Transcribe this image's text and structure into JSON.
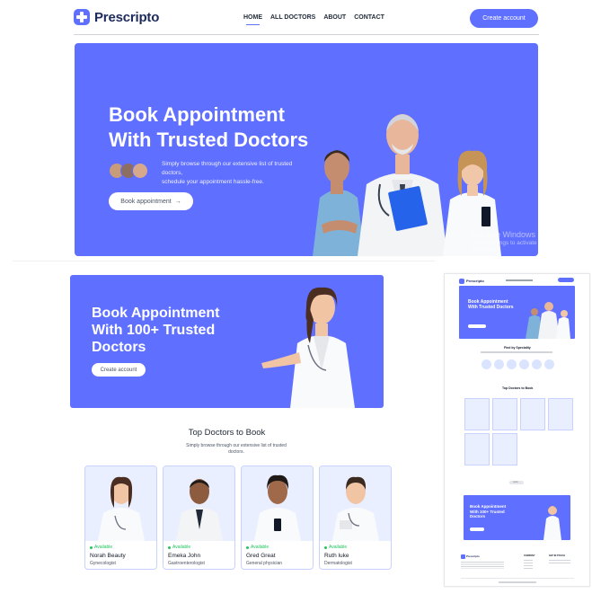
{
  "brand": {
    "name": "Prescripto"
  },
  "nav": {
    "links": [
      "HOME",
      "ALL DOCTORS",
      "ABOUT",
      "CONTACT"
    ],
    "cta": "Create account"
  },
  "hero": {
    "title_line1": "Book Appointment",
    "title_line2": "With Trusted Doctors",
    "subtitle_line1": "Simply browse through our extensive list of trusted doctors,",
    "subtitle_line2": "schedule your appointment hassle-free.",
    "button": "Book appointment",
    "arrow": "→"
  },
  "os_watermark": {
    "line1": "Activate Windows",
    "line2": "Go to Settings to activate Windows."
  },
  "banner": {
    "title_line1": "Book Appointment",
    "title_line2": "With 100+ Trusted Doctors",
    "button": "Create account"
  },
  "top_doctors": {
    "title": "Top Doctors to Book",
    "subtitle": "Simply browse through our extensive list of trusted doctors.",
    "doctors": [
      {
        "status": "Available",
        "name": "Norah Beauty",
        "specialty": "Gynecologist"
      },
      {
        "status": "Available",
        "name": "Emeka John",
        "specialty": "Gastroenterologist"
      },
      {
        "status": "Available",
        "name": "Gred Great",
        "specialty": "General physician"
      },
      {
        "status": "Available",
        "name": "Ruth luke",
        "specialty": "Dermatologist"
      }
    ]
  },
  "mini_preview": {
    "brand": "Prescripto",
    "hero_title": "Book Appointment With Trusted Doctors",
    "specialty_title": "Find by Speciality",
    "doctors_title": "Top Doctors to Book",
    "more": "more",
    "banner_title": "Book Appointment With 100+ Trusted Doctors",
    "footer_company": "COMPANY",
    "footer_contact": "GET IN TOUCH"
  },
  "colors": {
    "primary": "#5f6fff",
    "available": "#22c55e",
    "dark_text": "#1f2937"
  }
}
